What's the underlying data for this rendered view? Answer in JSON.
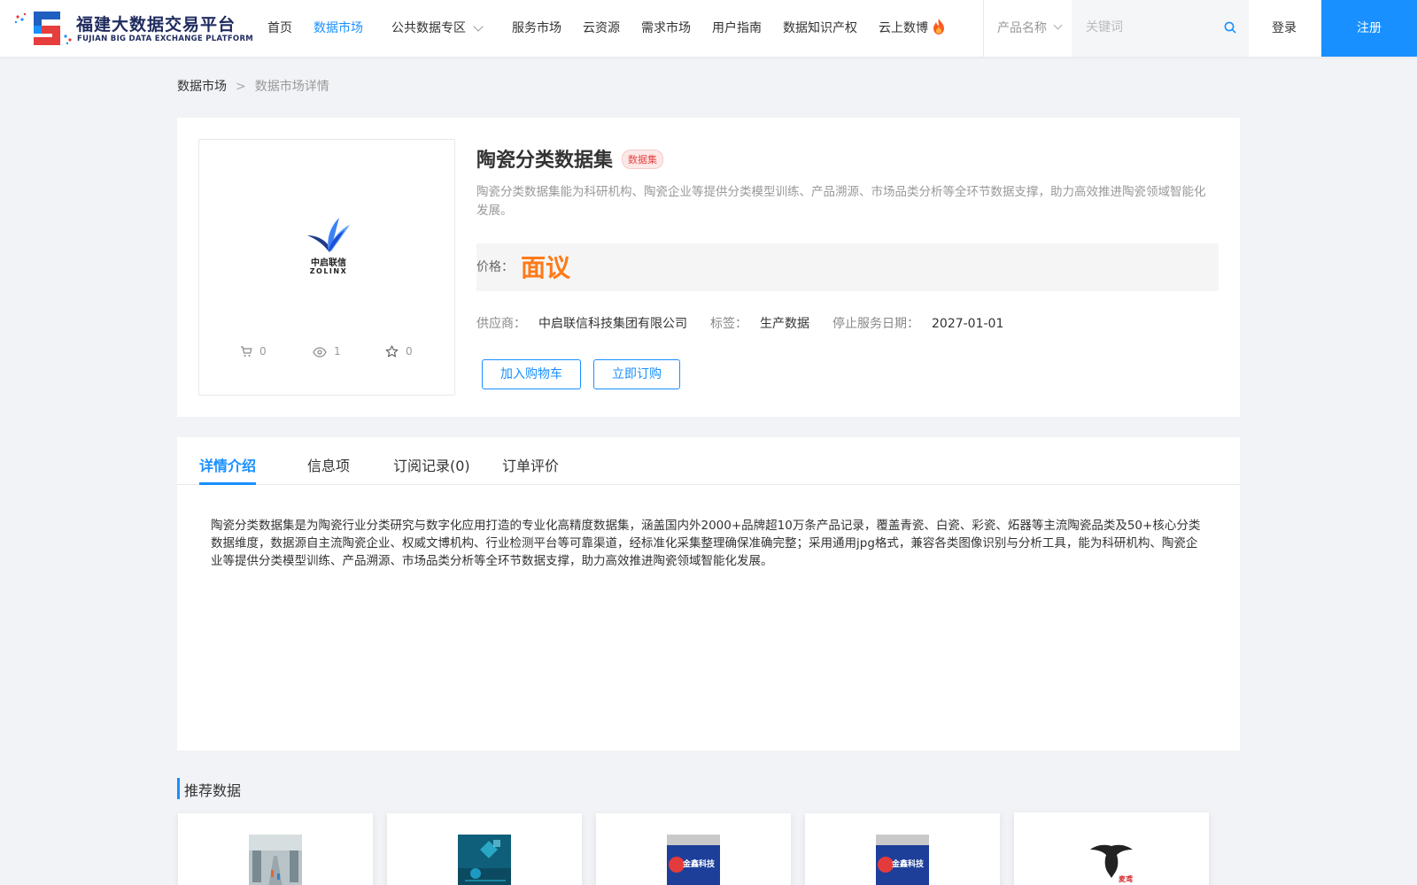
{
  "header": {
    "logo_cn": "福建大数据交易平台",
    "logo_en": "FUJIAN BIG DATA EXCHANGE  PLATFORM",
    "nav": [
      {
        "label": "首页"
      },
      {
        "label": "数据市场"
      },
      {
        "label": "公共数据专区"
      },
      {
        "label": "服务市场"
      },
      {
        "label": "云资源"
      },
      {
        "label": "需求市场"
      },
      {
        "label": "用户指南"
      },
      {
        "label": "数据知识产权"
      },
      {
        "label": "云上数博"
      }
    ],
    "search_type": "产品名称",
    "search_placeholder": "关键词",
    "login": "登录",
    "register": "注册",
    "accent_color": "#1890ff"
  },
  "breadcrumb": {
    "root": "数据市场",
    "separator": ">",
    "current": "数据市场详情"
  },
  "product": {
    "title": "陶瓷分类数据集",
    "tag": "数据集",
    "description": "陶瓷分类数据集能为科研机构、陶瓷企业等提供分类模型训练、产品溯源、市场品类分析等全环节数据支撑，助力高效推进陶瓷领域智能化发展。",
    "logo_cn": "中启联信",
    "logo_en": "ZOLINX",
    "stats": {
      "cart": "0",
      "views": "1",
      "favorites": "0"
    },
    "price_label": "价格：",
    "price": "面议",
    "supplier_label": "供应商：",
    "supplier": "中启联信科技集团有限公司",
    "tags_label": "标签：",
    "tags": "生产数据",
    "end_date_label": "停止服务日期：",
    "end_date": "2027-01-01",
    "add_cart": "加入购物车",
    "subscribe": "立即订购",
    "price_color": "#ff7a18"
  },
  "tabs": [
    {
      "label": "详情介绍"
    },
    {
      "label": "信息项"
    },
    {
      "label": "订阅记录(0)"
    },
    {
      "label": "订单评价"
    }
  ],
  "detail_text": "陶瓷分类数据集是为陶瓷行业分类研究与数字化应用打造的专业化高精度数据集，涵盖国内外2000+品牌超10万条产品记录，覆盖青瓷、白瓷、彩瓷、炻器等主流陶瓷品类及50+核心分类数据维度，数据源自主流陶瓷企业、权威文博机构、行业检测平台等可靠渠道，经标准化采集整理确保准确完整；采用通用jpg格式，兼容各类图像识别与分析工具，能为科研机构、陶瓷企业等提供分类模型训练、产品溯源、市场品类分析等全环节数据支撑，助力高效推进陶瓷领域智能化发展。",
  "recommended": {
    "title": "推荐数据",
    "thumb_logo_text": "金鑫科技",
    "thumb_brand_text": "麦鸢"
  }
}
